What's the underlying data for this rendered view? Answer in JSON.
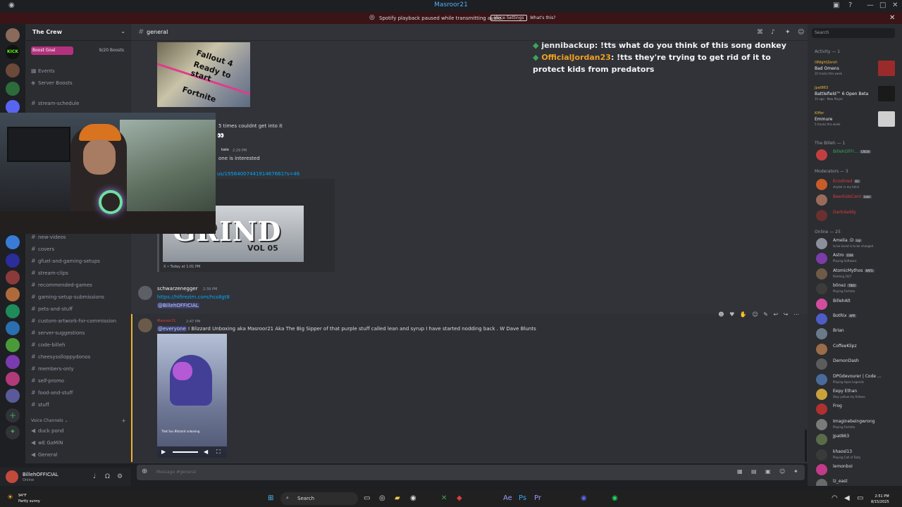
{
  "titlebar": {
    "title": "The Crew",
    "overlay_name": "Masroor21"
  },
  "notice": {
    "text": "Spotify playback paused while transmitting audio.",
    "button": "Voice Settings",
    "link": "What's this?"
  },
  "server": {
    "name": "The Crew",
    "boost_label": "Boost Goal",
    "boost_count": "9/20 Boosts",
    "boost_progress": 0.45
  },
  "channels": {
    "top_items": [
      "Events",
      "Server Boosts"
    ],
    "first_text": [
      "stream-schedule"
    ],
    "text_channels": [
      "new-videos",
      "covers",
      "gfuel-and-gaming-setups",
      "stream-clips",
      "recommended-games",
      "gaming-setup-submissions",
      "pets-and-stuff",
      "custom-artwork-for-commission",
      "server-suggestions",
      "code-billeh",
      "cheesysslloppydonos",
      "members-only",
      "self-promo",
      "food-and-stuff",
      "stuff"
    ],
    "voice_category": "Voice Channels",
    "voice_channels": [
      "duck pond",
      "wE GaMiN",
      "General"
    ]
  },
  "header": {
    "channel": "general",
    "search_placeholder": "Search"
  },
  "chat_overlay": {
    "line1_user": "jennibackup",
    "line1_text": ": !tts what do you think of this song donkey",
    "line2_user": "OfficialJordan23",
    "line2_text": ": !tts they're trying to get rid of it to protect kids from predators"
  },
  "messages": {
    "fallout_title": "Fallout 4",
    "fallout_sub": "Ready to start",
    "fortnite": "Fortnite",
    "m1_text": "5 times couldnt get into it",
    "m1_emoji": "👀",
    "m2_author": "kate",
    "m2_time": "2:29 PM",
    "m2_text": "one is interested",
    "m3_link": "us/1956400744191467661?s=46",
    "embed_title": "GRIND",
    "embed_vol": "VOL 05",
    "embed_footer": "X • Today at 1:01 PM",
    "m4_author": "schwarzenegger",
    "m4_time": "2:39 PM",
    "m4_link": "https://hifirezim.com/hcs8gt8",
    "m4_mention": "@BillehOFFICIAL",
    "m5_author": "Masroor21",
    "m5_time": "2:47 PM",
    "m5_mention": "@everyone",
    "m5_text": " I Blizzard Unboxing aka Masroor21 Aka The Big Sipper of that purple stuff called lean and syrup I have started nodding back . W Dave Blunts",
    "video_caption": "That Sus Blizzard unboxing"
  },
  "composer": {
    "placeholder": "Message #general"
  },
  "user_panel": {
    "name": "BillehOFFICIAL",
    "status": "Online"
  },
  "right_panel": {
    "activity_head": "Activity — 1",
    "activities": [
      {
        "user": "lilNightZeroll",
        "title": "Bad Omens",
        "sub": "35 tracks this week",
        "color": "#9b2b2b"
      },
      {
        "user": "Jpat863",
        "title": "Battlefield™ 6 Open Beta",
        "sub": "1h ago · New Player",
        "color": "#1a1a1a"
      },
      {
        "user": "Kiffer",
        "title": "Emmure",
        "sub": "5 tracks this week",
        "color": "#cfcfcf"
      }
    ],
    "billeh_head": "The Billeh — 1",
    "billeh_members": [
      {
        "name": "BillehOFFI...",
        "tag": "CREW",
        "color": "#c23f3f",
        "name_color": "#3ba55d"
      }
    ],
    "mods_head": "Moderators — 3",
    "mods": [
      {
        "name": "Ecoshred",
        "tag": "63",
        "status": "stryker is my bitch",
        "color": "#c75c2a",
        "name_color": "#e03c3c"
      },
      {
        "name": "BeerkidsCent",
        "tag": "kate",
        "status": "",
        "color": "#9a6b5a",
        "name_color": "#e03c3c"
      },
      {
        "name": "Darkdaddy",
        "tag": "",
        "status": "",
        "color": "#6a2f2f",
        "name_color": "#e03c3c"
      }
    ],
    "online_head": "Online — 25",
    "online": [
      {
        "name": "Amelia :D",
        "tag": "ivy",
        "status": "to be loved is to be changed",
        "color": "#8a8f9a"
      },
      {
        "name": "Astro",
        "tag": "CUH",
        "status": "Playing Software",
        "color": "#7b3ca8"
      },
      {
        "name": "AtomicMythos",
        "tag": "RATS",
        "status": "Painting 24/7",
        "color": "#6f5a48"
      },
      {
        "name": "b0nez",
        "tag": "TBOI",
        "status": "Playing Fortnite",
        "color": "#3c3c3c"
      },
      {
        "name": "BillehAlt",
        "tag": "",
        "status": "",
        "color": "#d24d9e"
      },
      {
        "name": "BotRix",
        "tag": "APP",
        "status": "",
        "color": "#4f5cc7"
      },
      {
        "name": "Brian",
        "tag": "",
        "status": "",
        "color": "#6a7a8a"
      },
      {
        "name": "CoffeeKlipz",
        "tag": "",
        "status": "",
        "color": "#9b6b4a"
      },
      {
        "name": "DemonDash",
        "tag": "",
        "status": "",
        "color": "#5c5c5c"
      },
      {
        "name": "DPGdevourer | Code ...",
        "tag": "",
        "status": "Playing Apex Legends",
        "color": "#4a6b9a"
      },
      {
        "name": "Eepy Ethan",
        "tag": "",
        "status": "Stay yellow my fellows",
        "color": "#c9a23a"
      },
      {
        "name": "Frog",
        "tag": "",
        "status": "",
        "color": "#b03030"
      },
      {
        "name": "Imaginebeingwrong",
        "tag": "",
        "status": "Playing Fortnite",
        "color": "#7a7a7a"
      },
      {
        "name": "Jpat863",
        "tag": "",
        "status": "",
        "color": "#5a6b4a"
      },
      {
        "name": "khaosl13",
        "tag": "",
        "status": "Playing Call of Duty",
        "color": "#3a3a3a"
      },
      {
        "name": "lemonboi",
        "tag": "",
        "status": "",
        "color": "#c43a8a"
      },
      {
        "name": "lz_east",
        "tag": "",
        "status": "",
        "color": "#6a6a6a"
      }
    ]
  },
  "taskbar": {
    "weather_temp": "94°F",
    "weather_desc": "Partly sunny",
    "search": "Search",
    "time": "2:51 PM",
    "date": "8/15/2025"
  },
  "colors": {
    "bg": "#313338",
    "sidebar": "#2b2d31",
    "accent": "#5865f2",
    "boost": "#b4317e",
    "link": "#00a8fc"
  }
}
